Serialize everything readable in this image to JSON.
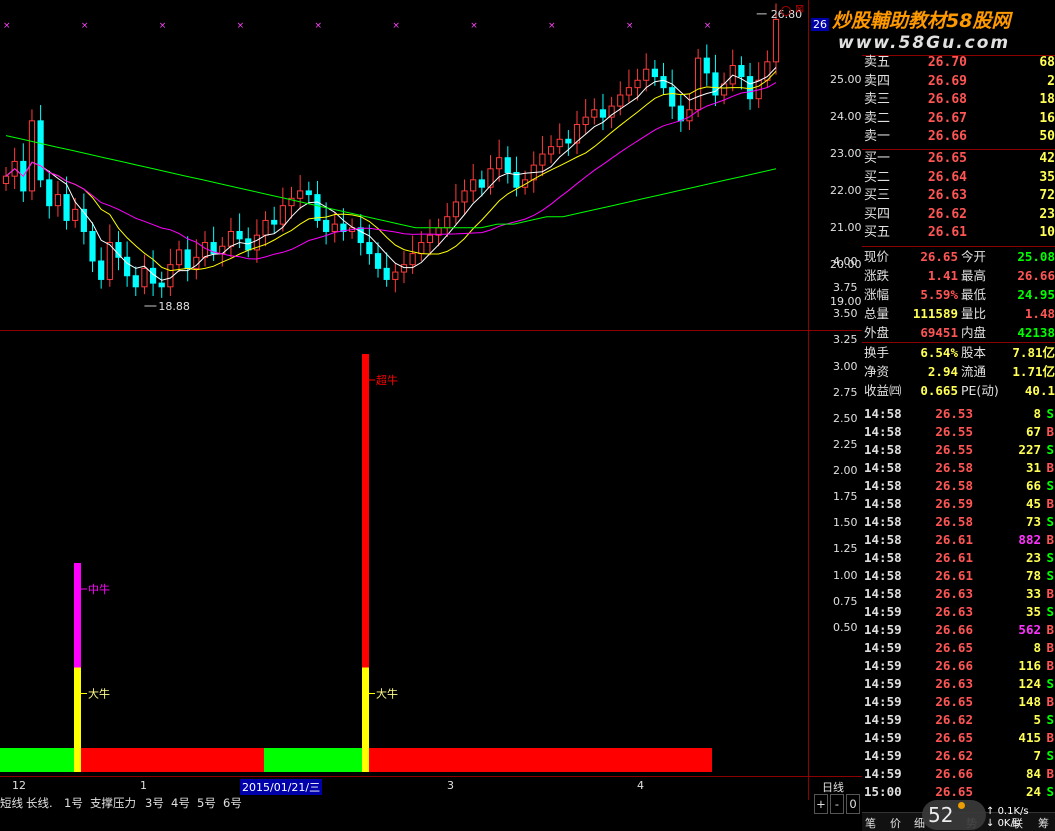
{
  "watermark": {
    "text": "炒股輔助教材58股网",
    "url": "www.58Gu.com"
  },
  "main_chart": {
    "price_labels": [
      "25.00",
      "24.00",
      "23.00",
      "22.00",
      "21.00",
      "20.00",
      "19.00"
    ],
    "high_marker": "26.80",
    "low_marker": "18.88",
    "corner_value": "26",
    "colors": {
      "up": "#ff3b3b",
      "down": "#00ffff",
      "ma5": "#ffffff",
      "ma10": "#ffff00",
      "ma20": "#ff00ff",
      "ma60": "#00ff00"
    }
  },
  "chart_data": [
    {
      "type": "candlestick",
      "title": "",
      "ylim": [
        18.5,
        27.0
      ],
      "low": 18.88,
      "high": 26.8,
      "close_series": [
        22.4,
        22.8,
        22.0,
        23.9,
        22.3,
        21.6,
        21.9,
        21.2,
        21.5,
        20.9,
        20.1,
        19.6,
        20.6,
        20.2,
        19.7,
        19.4,
        19.9,
        19.5,
        19.4,
        20.0,
        20.4,
        19.9,
        20.2,
        20.6,
        20.3,
        20.5,
        20.9,
        20.7,
        20.4,
        20.8,
        21.2,
        21.1,
        21.6,
        21.8,
        22.0,
        21.9,
        21.2,
        20.9,
        21.1,
        20.9,
        21.0,
        20.6,
        20.3,
        19.9,
        19.6,
        19.8,
        20.0,
        20.3,
        20.6,
        20.8,
        21.0,
        21.3,
        21.7,
        22.0,
        22.3,
        22.1,
        22.6,
        22.9,
        22.5,
        22.1,
        22.3,
        22.7,
        23.0,
        23.2,
        23.4,
        23.3,
        23.8,
        24.0,
        24.2,
        24.0,
        24.3,
        24.6,
        24.8,
        25.0,
        25.3,
        25.1,
        24.8,
        24.3,
        23.9,
        24.2,
        25.6,
        25.2,
        24.6,
        24.9,
        25.4,
        25.1,
        24.5,
        25.0,
        25.5,
        26.65
      ],
      "series": [
        {
          "name": "MA60",
          "values": [
            23.5,
            23.4,
            23.3,
            23.2,
            23.1,
            23.0,
            22.9,
            22.8,
            22.7,
            22.6,
            22.5,
            22.4,
            22.3,
            22.2,
            22.1,
            22.0,
            21.9,
            21.8,
            21.7,
            21.6,
            21.5,
            21.4,
            21.3,
            21.2,
            21.1,
            21.0,
            21.0,
            21.0,
            21.0,
            21.0,
            21.1,
            21.1,
            21.2,
            21.3,
            21.3,
            21.4,
            21.5,
            21.6,
            21.7,
            21.8,
            21.9,
            22.0,
            22.1,
            22.2,
            22.3,
            22.4,
            22.5,
            22.6
          ]
        }
      ]
    },
    {
      "type": "bar",
      "title": "",
      "ylim": [
        0,
        4.25
      ],
      "yticks": [
        "4.00",
        "3.75",
        "3.50",
        "3.25",
        "3.00",
        "2.75",
        "2.50",
        "2.25",
        "2.00",
        "1.75",
        "1.50",
        "1.25",
        "1.00",
        "0.75",
        "0.50"
      ],
      "signals": [
        {
          "bar_index": 19,
          "segments": [
            {
              "from": 0,
              "to": 1.0,
              "color": "#ffff00",
              "label": "大牛"
            },
            {
              "from": 1.0,
              "to": 2.0,
              "color": "#ff00ff",
              "label": "中牛"
            }
          ]
        },
        {
          "bar_index": 91,
          "segments": [
            {
              "from": 0,
              "to": 1.0,
              "color": "#ffff00",
              "label": "大牛"
            },
            {
              "from": 1.0,
              "to": 4.0,
              "color": "#ff0000",
              "label": "超牛"
            }
          ]
        }
      ],
      "band": [
        {
          "from": 0,
          "to": 19,
          "color": "#00ff00"
        },
        {
          "from": 19,
          "to": 66,
          "color": "#ff0000"
        },
        {
          "from": 66,
          "to": 91,
          "color": "#00ff00"
        },
        {
          "from": 91,
          "to": 178,
          "color": "#ff0000"
        }
      ]
    }
  ],
  "x_axis": {
    "ticks": [
      "12",
      "1",
      "2015/01/21/三",
      "3",
      "4"
    ],
    "period": "日线"
  },
  "bottom_tabs": [
    "短线",
    "长线.",
    "1号",
    "支撑压力",
    "3号",
    "4号",
    "5号",
    "6号"
  ],
  "nav_buttons": [
    "+",
    "-",
    "0"
  ],
  "order_book": {
    "asks": [
      {
        "name": "卖五",
        "price": "26.70",
        "vol": "68"
      },
      {
        "name": "卖四",
        "price": "26.69",
        "vol": "2"
      },
      {
        "name": "卖三",
        "price": "26.68",
        "vol": "18"
      },
      {
        "name": "卖二",
        "price": "26.67",
        "vol": "16"
      },
      {
        "name": "卖一",
        "price": "26.66",
        "vol": "50"
      }
    ],
    "bids": [
      {
        "name": "买一",
        "price": "26.65",
        "vol": "42"
      },
      {
        "name": "买二",
        "price": "26.64",
        "vol": "35"
      },
      {
        "name": "买三",
        "price": "26.63",
        "vol": "72"
      },
      {
        "name": "买四",
        "price": "26.62",
        "vol": "23"
      },
      {
        "name": "买五",
        "price": "26.61",
        "vol": "10"
      }
    ]
  },
  "quote": [
    {
      "n1": "现价",
      "v1": "26.65",
      "c1": "#ff5555",
      "n2": "今开",
      "v2": "25.08",
      "c2": "#00ff00"
    },
    {
      "n1": "涨跌",
      "v1": "1.41",
      "c1": "#ff5555",
      "n2": "最高",
      "v2": "26.66",
      "c2": "#ff5555"
    },
    {
      "n1": "涨幅",
      "v1": "5.59%",
      "c1": "#ff5555",
      "n2": "最低",
      "v2": "24.95",
      "c2": "#00ff00"
    },
    {
      "n1": "总量",
      "v1": "111589",
      "c1": "#ffff55",
      "n2": "量比",
      "v2": "1.48",
      "c2": "#ff5555"
    },
    {
      "n1": "外盘",
      "v1": "69451",
      "c1": "#ff5555",
      "n2": "内盘",
      "v2": "42138",
      "c2": "#00ff00"
    },
    {
      "n1": "换手",
      "v1": "6.54%",
      "c1": "#ffff55",
      "n2": "股本",
      "v2": "7.81亿",
      "c2": "#ffff55"
    },
    {
      "n1": "净资",
      "v1": "2.94",
      "c1": "#ffff55",
      "n2": "流通",
      "v2": "1.71亿",
      "c2": "#ffff55"
    },
    {
      "n1": "收益㈣",
      "v1": "0.665",
      "c1": "#ffff55",
      "n2": "PE(动)",
      "v2": "40.1",
      "c2": "#ffff55"
    }
  ],
  "ticks": [
    {
      "time": "14:58",
      "price": "26.53",
      "vol": "8",
      "side": "S"
    },
    {
      "time": "14:58",
      "price": "26.55",
      "vol": "67",
      "side": "B"
    },
    {
      "time": "14:58",
      "price": "26.55",
      "vol": "227",
      "side": "S"
    },
    {
      "time": "14:58",
      "price": "26.58",
      "vol": "31",
      "side": "B"
    },
    {
      "time": "14:58",
      "price": "26.58",
      "vol": "66",
      "side": "S"
    },
    {
      "time": "14:58",
      "price": "26.59",
      "vol": "45",
      "side": "B"
    },
    {
      "time": "14:58",
      "price": "26.58",
      "vol": "73",
      "side": "S"
    },
    {
      "time": "14:58",
      "price": "26.61",
      "vol": "882",
      "side": "B"
    },
    {
      "time": "14:58",
      "price": "26.61",
      "vol": "23",
      "side": "S"
    },
    {
      "time": "14:58",
      "price": "26.61",
      "vol": "78",
      "side": "S"
    },
    {
      "time": "14:58",
      "price": "26.63",
      "vol": "33",
      "side": "B"
    },
    {
      "time": "14:59",
      "price": "26.63",
      "vol": "35",
      "side": "S"
    },
    {
      "time": "14:59",
      "price": "26.66",
      "vol": "562",
      "side": "B"
    },
    {
      "time": "14:59",
      "price": "26.65",
      "vol": "8",
      "side": "B"
    },
    {
      "time": "14:59",
      "price": "26.66",
      "vol": "116",
      "side": "B"
    },
    {
      "time": "14:59",
      "price": "26.63",
      "vol": "124",
      "side": "S"
    },
    {
      "time": "14:59",
      "price": "26.65",
      "vol": "148",
      "side": "B"
    },
    {
      "time": "14:59",
      "price": "26.62",
      "vol": "5",
      "side": "S"
    },
    {
      "time": "14:59",
      "price": "26.65",
      "vol": "415",
      "side": "B"
    },
    {
      "time": "14:59",
      "price": "26.62",
      "vol": "7",
      "side": "S"
    },
    {
      "time": "14:59",
      "price": "26.66",
      "vol": "84",
      "side": "B"
    },
    {
      "time": "15:00",
      "price": "26.65",
      "vol": "24",
      "side": "S"
    }
  ],
  "status": {
    "tabs": [
      "笔",
      "价",
      "细",
      "势",
      "联",
      "筹"
    ],
    "badge": "52",
    "net_up": "0.1K/s",
    "net_down": "0K/s"
  }
}
